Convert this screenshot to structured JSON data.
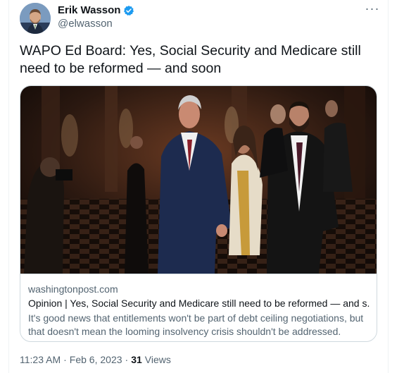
{
  "author": {
    "display_name": "Erik Wasson",
    "handle": "@elwasson",
    "verified_color": "#1d9bf0"
  },
  "more_icon": "···",
  "tweet": {
    "text": "WAPO Ed Board: Yes, Social Security and Medicare still need to be reformed — and soon"
  },
  "card": {
    "domain": "washingtonpost.com",
    "title": "Opinion | Yes, Social Security and Medicare still need to be reformed — and s...",
    "description": "It's good news that entitlements won't be part of debt ceiling negotiations, but that doesn't mean the looming insolvency crisis shouldn't be addressed."
  },
  "footer": {
    "time": "11:23 AM",
    "separator": "·",
    "date": "Feb 6, 2023",
    "views_count": "31",
    "views_label": "Views"
  },
  "colors": {
    "text_primary": "#0f1419",
    "text_secondary": "#536471",
    "border": "#cfd9de",
    "suit_navy": "#1d2b4f"
  }
}
